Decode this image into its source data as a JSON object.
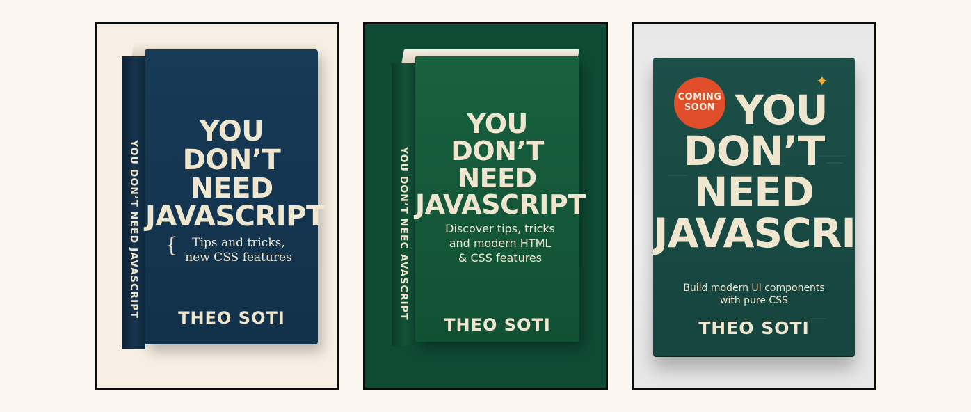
{
  "books": [
    {
      "title_lines": [
        "YOU",
        "DON’T NEED",
        "JAVASCRIPT"
      ],
      "spine_text": "YOU DON’T NEED JAVASCRIPT",
      "subtitle_lines": [
        "Tips and tricks,",
        "new CSS features"
      ],
      "brace": "{",
      "author": "THEO SOTI",
      "colors": {
        "cover": "#173a56",
        "background": "#f7efe3",
        "text": "#efe6cf"
      }
    },
    {
      "title_lines": [
        "YOU",
        "DON’T NEED",
        "JAVASCRIPT"
      ],
      "spine_text": "YOU DON’T NEEC AVASCRIPT",
      "subtitle_lines": [
        "Discover tips, tricks",
        "and modern HTML",
        "& CSS features"
      ],
      "author": "THEO SOTI",
      "colors": {
        "cover": "#18613f",
        "background": "#0f4a35",
        "text": "#efe6cf"
      }
    },
    {
      "title_lines": [
        "YOU",
        "DON’T",
        "NEED",
        "JAVASCRIPT"
      ],
      "badge_lines": [
        "COMING",
        "SOON"
      ],
      "sparkle_icon": "sparkle-icon",
      "subtitle_lines": [
        "Build modern UI components",
        "with pure CSS"
      ],
      "author": "THEO SOTI",
      "colors": {
        "cover": "#1b4f48",
        "background": "#ececec",
        "badge": "#e04e2a",
        "sparkle": "#f0b23a",
        "text": "#efe6cf"
      }
    }
  ]
}
